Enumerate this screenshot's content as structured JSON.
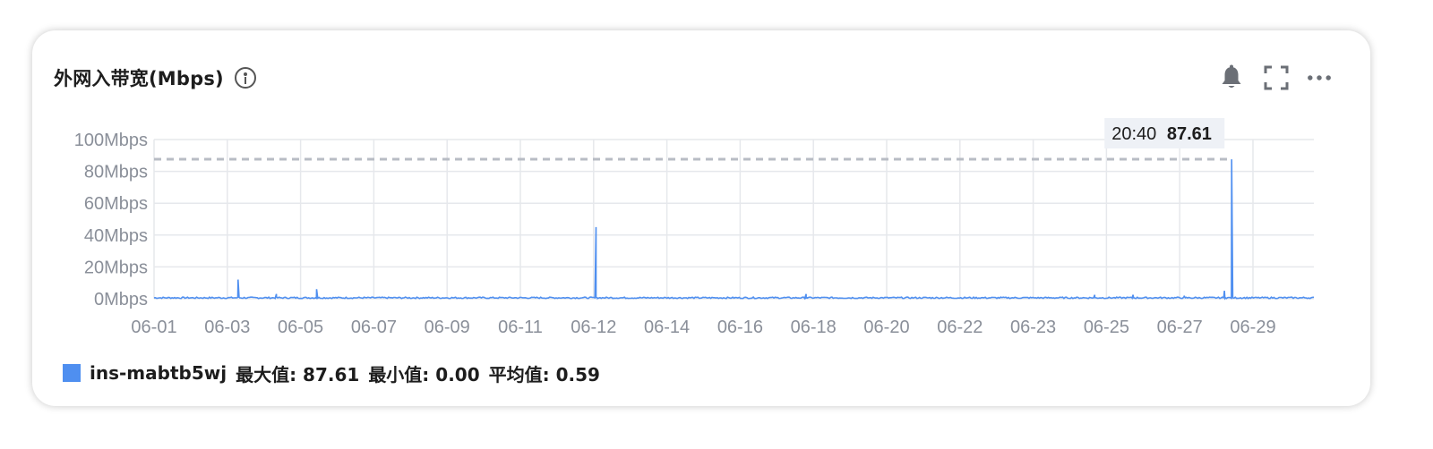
{
  "card": {
    "title": "外网入带宽(Mbps)",
    "icons": {
      "info": "info-icon",
      "alarm": "bell-icon",
      "fullscreen": "fullscreen-icon",
      "more": "more-icon"
    }
  },
  "legend": {
    "series_name": "ins-mabtb5wj",
    "max_text": "最大值: 87.61",
    "min_text": "最小值: 0.00",
    "avg_text": "平均值: 0.59"
  },
  "tooltip": {
    "time": "20:40",
    "value": "87.61"
  },
  "colors": {
    "series": "#4f8ff0",
    "grid": "#e6e8ec",
    "markline": "#b8bcc4",
    "axis_text": "#8a8f99"
  },
  "chart_data": {
    "type": "line",
    "x_ticks": [
      "06-01",
      "06-03",
      "06-05",
      "06-07",
      "06-09",
      "06-11",
      "06-12",
      "06-14",
      "06-16",
      "06-18",
      "06-20",
      "06-22",
      "06-23",
      "06-25",
      "06-27",
      "06-29"
    ],
    "y_ticks": [
      "100Mbps",
      "80Mbps",
      "60Mbps",
      "40Mbps",
      "20Mbps",
      "0Mbps"
    ],
    "ylim": [
      0,
      100
    ],
    "x_range": [
      0,
      31.75
    ],
    "baseline": 0.6,
    "markline_value": 87.61,
    "spikes": [
      {
        "x": 2.3,
        "y": 12
      },
      {
        "x": 3.35,
        "y": 3
      },
      {
        "x": 4.45,
        "y": 6
      },
      {
        "x": 12.1,
        "y": 45
      },
      {
        "x": 17.85,
        "y": 3
      },
      {
        "x": 25.75,
        "y": 2.5
      },
      {
        "x": 26.8,
        "y": 2.5
      },
      {
        "x": 28.2,
        "y": 1.5
      },
      {
        "x": 29.3,
        "y": 5
      },
      {
        "x": 29.5,
        "y": 87.61
      }
    ],
    "grid": true
  }
}
